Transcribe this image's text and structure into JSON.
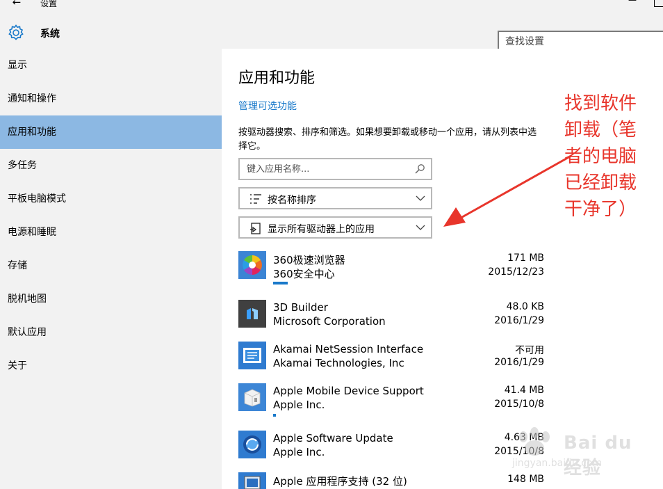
{
  "window": {
    "title": "设置",
    "back_glyph": "←",
    "minimize_glyph": "—"
  },
  "header": {
    "title": "系统",
    "search_placeholder": "查找设置"
  },
  "sidebar": {
    "items": [
      {
        "label": "显示",
        "active": false
      },
      {
        "label": "通知和操作",
        "active": false
      },
      {
        "label": "应用和功能",
        "active": true
      },
      {
        "label": "多任务",
        "active": false
      },
      {
        "label": "平板电脑模式",
        "active": false
      },
      {
        "label": "电源和睡眠",
        "active": false
      },
      {
        "label": "存储",
        "active": false
      },
      {
        "label": "脱机地图",
        "active": false
      },
      {
        "label": "默认应用",
        "active": false
      },
      {
        "label": "关于",
        "active": false
      }
    ]
  },
  "main": {
    "title": "应用和功能",
    "manage_link": "管理可选功能",
    "description": "按驱动器搜索、排序和筛选。如果想要卸载或移动一个应用，请从列表中选择它。",
    "search_placeholder": "键入应用名称...",
    "sort_label": "按名称排序",
    "filter_label": "显示所有驱动器上的应用",
    "apps": [
      {
        "name": "360极速浏览器",
        "publisher": "360安全中心",
        "size": "171 MB",
        "date": "2015/12/23",
        "icon": "360-browser-icon",
        "usage": 0.3
      },
      {
        "name": "3D Builder",
        "publisher": "Microsoft Corporation",
        "size": "48.0 KB",
        "date": "2016/1/29",
        "icon": "3d-builder-icon",
        "usage": 0
      },
      {
        "name": "Akamai NetSession Interface",
        "publisher": "Akamai Technologies, Inc",
        "size": "不可用",
        "date": "2016/1/29",
        "icon": "akamai-icon",
        "usage": 0
      },
      {
        "name": "Apple Mobile Device Support",
        "publisher": "Apple Inc.",
        "size": "41.4 MB",
        "date": "2015/10/8",
        "icon": "apple-mobile-icon",
        "usage": 0.05
      },
      {
        "name": "Apple Software Update",
        "publisher": "Apple Inc.",
        "size": "4.63 MB",
        "date": "2015/10/8",
        "icon": "apple-update-icon",
        "usage": 0
      },
      {
        "name": "Apple 应用程序支持 (32 位)",
        "publisher": "",
        "size": "148 MB",
        "date": "",
        "icon": "apple-support-icon",
        "usage": 0
      }
    ]
  },
  "annotation": {
    "text": "找到软件卸载（笔者的电脑已经卸载干净了）",
    "color": "#e8352b"
  },
  "watermark": {
    "text": "Bai du 经验",
    "sub": "jingyan.baidu.com"
  },
  "colors": {
    "accent": "#1979ca",
    "sidebar_active": "#8cb8e3",
    "sidebar_bg": "#f2f2f2"
  }
}
